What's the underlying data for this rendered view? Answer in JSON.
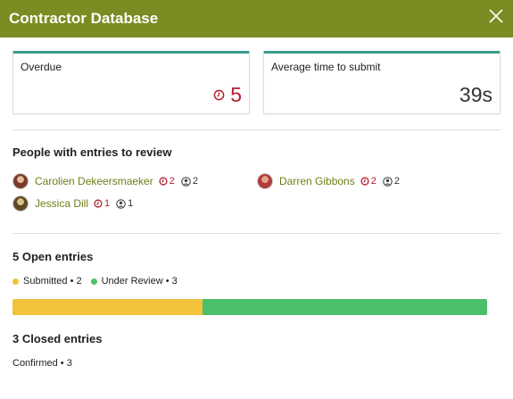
{
  "header": {
    "title": "Contractor Database",
    "accent": "#7b8c22"
  },
  "cards": {
    "overdue": {
      "label": "Overdue",
      "value": "5",
      "icon": "clock-icon"
    },
    "avg_time": {
      "label": "Average time to submit",
      "value": "39s"
    }
  },
  "review": {
    "title": "People with entries to review",
    "people": [
      {
        "name": "Carolien Dekeersmaeker",
        "overdue": "2",
        "assigned": "2"
      },
      {
        "name": "Darren Gibbons",
        "overdue": "2",
        "assigned": "2"
      },
      {
        "name": "Jessica Dill",
        "overdue": "1",
        "assigned": "1"
      }
    ]
  },
  "open": {
    "title": "5 Open entries",
    "legend": [
      {
        "label": "Submitted • 2",
        "color": "#f2c23a",
        "count": 2
      },
      {
        "label": "Under Review • 3",
        "color": "#4cbf6b",
        "count": 3
      }
    ],
    "total": 5
  },
  "closed": {
    "title": "3 Closed entries",
    "line": "Confirmed • 3"
  }
}
